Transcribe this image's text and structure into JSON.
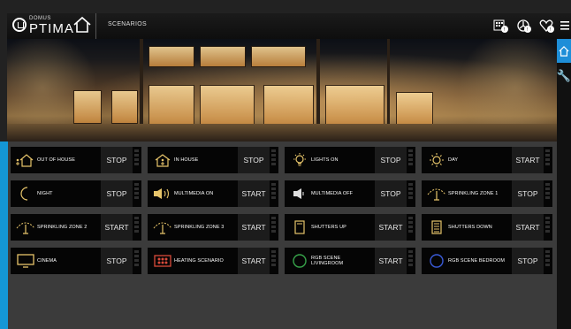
{
  "header": {
    "logo_small": "DOMUS",
    "logo_big": "PTIMA",
    "breadcrumb": "SCENARIOS"
  },
  "scenarios": [
    {
      "label": "OUT OF HOUSE",
      "action": "STOP",
      "icon": "exit-house-icon"
    },
    {
      "label": "IN HOUSE",
      "action": "STOP",
      "icon": "in-house-icon"
    },
    {
      "label": "LIGHTS ON",
      "action": "STOP",
      "icon": "bulb-icon"
    },
    {
      "label": "DAY",
      "action": "START",
      "icon": "sun-icon"
    },
    {
      "label": "NIGHT",
      "action": "STOP",
      "icon": "moon-icon"
    },
    {
      "label": "MULTIMEDIA ON",
      "action": "START",
      "icon": "speaker-on-icon"
    },
    {
      "label": "MULTIMEDIA OFF",
      "action": "STOP",
      "icon": "speaker-off-icon"
    },
    {
      "label": "SPRINKLING ZONE 1",
      "action": "STOP",
      "icon": "sprinkler-icon"
    },
    {
      "label": "SPRINKLING ZONE 2",
      "action": "START",
      "icon": "sprinkler-icon"
    },
    {
      "label": "SPRINKLING ZONE 3",
      "action": "START",
      "icon": "sprinkler-icon"
    },
    {
      "label": "SHUTTERS UP",
      "action": "START",
      "icon": "shutter-up-icon"
    },
    {
      "label": "SHUTTERS DOWN",
      "action": "START",
      "icon": "shutter-down-icon"
    },
    {
      "label": "CINEMA",
      "action": "STOP",
      "icon": "tv-icon"
    },
    {
      "label": "HEATING SCENARIO",
      "action": "START",
      "icon": "heating-icon"
    },
    {
      "label": "RGB SCENE\nLIVINGROOM",
      "action": "START",
      "icon": "rgb-circle-icon"
    },
    {
      "label": "RGB SCENE BEDROOM",
      "action": "STOP",
      "icon": "rgb-circle-icon"
    }
  ],
  "colors": {
    "accent": "#1497d5",
    "tile_bg": "#050505",
    "rgb_bedroom_ring": "#3a5bd9",
    "rgb_living_ring": "#37a34a"
  }
}
